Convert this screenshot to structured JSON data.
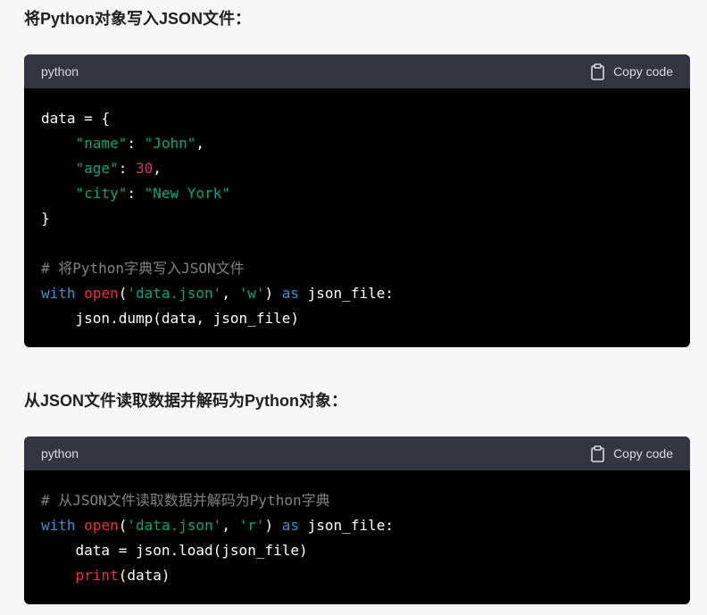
{
  "section1": {
    "heading": "将Python对象写入JSON文件：",
    "block": {
      "lang": "python",
      "copy_label": "Copy code",
      "lines": [
        [
          {
            "t": "data = {",
            "c": "plain"
          }
        ],
        [
          {
            "t": "    ",
            "c": "plain"
          },
          {
            "t": "\"name\"",
            "c": "str"
          },
          {
            "t": ": ",
            "c": "plain"
          },
          {
            "t": "\"John\"",
            "c": "str"
          },
          {
            "t": ",",
            "c": "plain"
          }
        ],
        [
          {
            "t": "    ",
            "c": "plain"
          },
          {
            "t": "\"age\"",
            "c": "str"
          },
          {
            "t": ": ",
            "c": "plain"
          },
          {
            "t": "30",
            "c": "num"
          },
          {
            "t": ",",
            "c": "plain"
          }
        ],
        [
          {
            "t": "    ",
            "c": "plain"
          },
          {
            "t": "\"city\"",
            "c": "str"
          },
          {
            "t": ": ",
            "c": "plain"
          },
          {
            "t": "\"New York\"",
            "c": "str"
          }
        ],
        [
          {
            "t": "}",
            "c": "plain"
          }
        ],
        [
          {
            "t": "",
            "c": "plain"
          }
        ],
        [
          {
            "t": "# 将Python字典写入JSON文件",
            "c": "com"
          }
        ],
        [
          {
            "t": "with",
            "c": "kw"
          },
          {
            "t": " ",
            "c": "plain"
          },
          {
            "t": "open",
            "c": "fn"
          },
          {
            "t": "(",
            "c": "plain"
          },
          {
            "t": "'data.json'",
            "c": "str"
          },
          {
            "t": ", ",
            "c": "plain"
          },
          {
            "t": "'w'",
            "c": "str"
          },
          {
            "t": ") ",
            "c": "plain"
          },
          {
            "t": "as",
            "c": "kw"
          },
          {
            "t": " json_file:",
            "c": "plain"
          }
        ],
        [
          {
            "t": "    json.dump(data, json_file)",
            "c": "plain"
          }
        ]
      ]
    }
  },
  "section2": {
    "heading": "从JSON文件读取数据并解码为Python对象：",
    "block": {
      "lang": "python",
      "copy_label": "Copy code",
      "lines": [
        [
          {
            "t": "# 从JSON文件读取数据并解码为Python字典",
            "c": "com"
          }
        ],
        [
          {
            "t": "with",
            "c": "kw"
          },
          {
            "t": " ",
            "c": "plain"
          },
          {
            "t": "open",
            "c": "fn"
          },
          {
            "t": "(",
            "c": "plain"
          },
          {
            "t": "'data.json'",
            "c": "str"
          },
          {
            "t": ", ",
            "c": "plain"
          },
          {
            "t": "'r'",
            "c": "str"
          },
          {
            "t": ") ",
            "c": "plain"
          },
          {
            "t": "as",
            "c": "kw"
          },
          {
            "t": " json_file:",
            "c": "plain"
          }
        ],
        [
          {
            "t": "    data = json.load(json_file)",
            "c": "plain"
          }
        ],
        [
          {
            "t": "    ",
            "c": "plain"
          },
          {
            "t": "print",
            "c": "fn"
          },
          {
            "t": "(data)",
            "c": "plain"
          }
        ]
      ]
    }
  },
  "colors": {
    "keyword": "#2e95d3",
    "builtin": "#f22c3d",
    "string": "#00a67d",
    "number": "#df3079",
    "comment": "#8a8a8a",
    "code_bg": "#000000",
    "header_bg": "#343541",
    "page_bg": "#f7f7f8"
  },
  "icons": {
    "copy": "clipboard-icon"
  }
}
